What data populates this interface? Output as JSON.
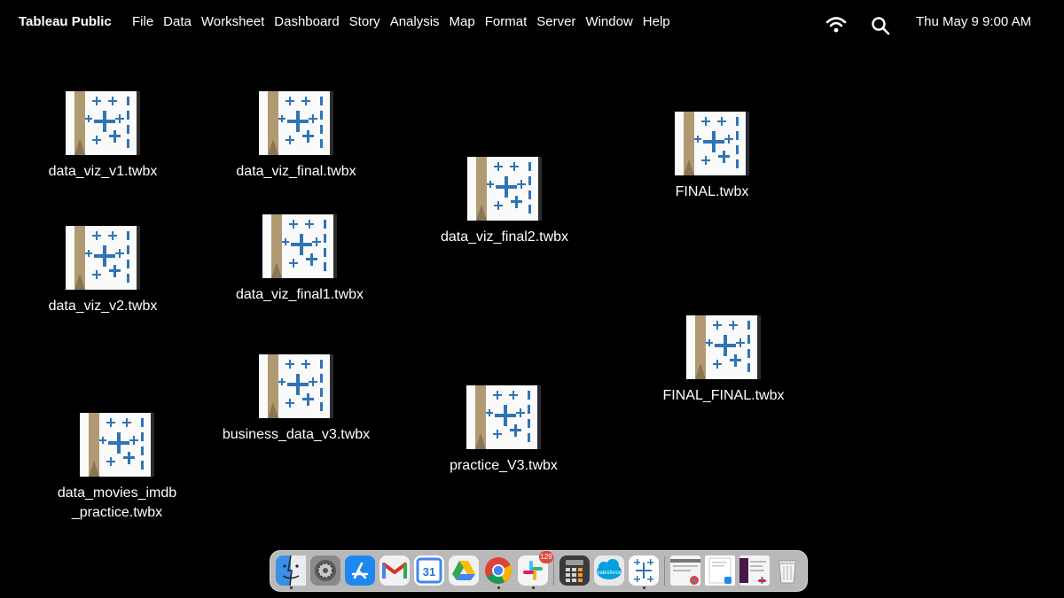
{
  "menubar": {
    "app_name": "Tableau Public",
    "menus": [
      "File",
      "Data",
      "Worksheet",
      "Dashboard",
      "Story",
      "Analysis",
      "Map",
      "Format",
      "Server",
      "Window",
      "Help"
    ],
    "clock": "Thu May 9  9:00 AM",
    "status_icons": [
      "wifi-icon",
      "search-icon"
    ]
  },
  "desktop": {
    "files": [
      {
        "name": "data_viz_v1.twbx"
      },
      {
        "name": "data_viz_v2.twbx"
      },
      {
        "name": "data_movies_imdb\n_practice.twbx"
      },
      {
        "name": "data_viz_final.twbx"
      },
      {
        "name": "data_viz_final1.twbx"
      },
      {
        "name": "business_data_v3.twbx"
      },
      {
        "name": "data_viz_final2.twbx"
      },
      {
        "name": "practice_V3.twbx"
      },
      {
        "name": "FINAL.twbx"
      },
      {
        "name": "FINAL_FINAL.twbx"
      }
    ],
    "file_icon": "tableau-workbook-icon"
  },
  "dock": {
    "apps": [
      {
        "name": "finder-icon",
        "running": true
      },
      {
        "name": "system-settings-icon",
        "running": false
      },
      {
        "name": "app-store-icon",
        "running": false
      },
      {
        "name": "gmail-icon",
        "running": false
      },
      {
        "name": "google-calendar-icon",
        "label": "31",
        "running": false
      },
      {
        "name": "google-drive-icon",
        "running": false
      },
      {
        "name": "chrome-icon",
        "running": true
      },
      {
        "name": "slack-icon",
        "badge": "129",
        "running": true
      },
      {
        "name": "calculator-icon",
        "running": false
      },
      {
        "name": "salesforce-icon",
        "label": "salesforce",
        "running": false
      },
      {
        "name": "tableau-icon",
        "running": true
      }
    ],
    "recent": [
      "chrome-window-thumbnail",
      "document-thumbnail",
      "slack-window-thumbnail"
    ],
    "trash": "trash-icon"
  },
  "colors": {
    "background": "#000000",
    "tableau_blue": "#2f74b5",
    "spine_tan": "#b09a72"
  }
}
